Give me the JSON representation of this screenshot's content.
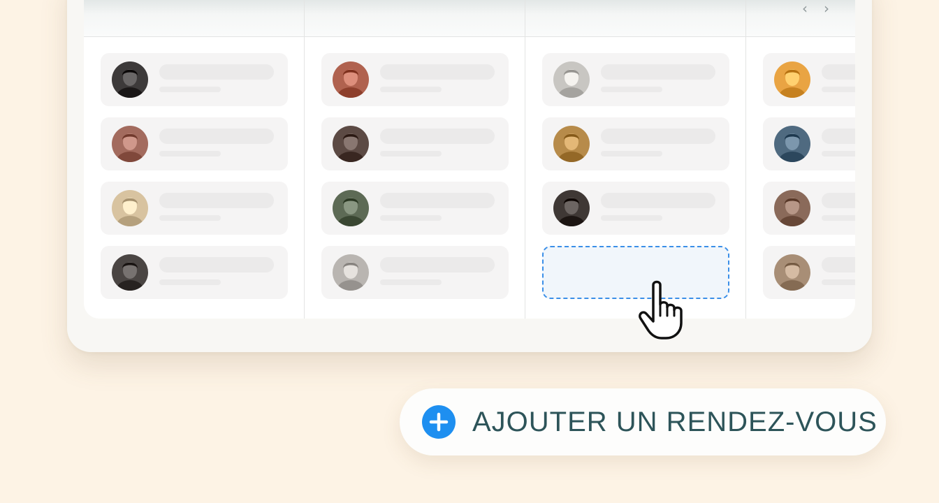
{
  "calendar": {
    "nav": {
      "prev_icon": "chevron-left-icon",
      "next_icon": "chevron-right-icon"
    },
    "columns": [
      {
        "avatars": [
          "#3d3a3a",
          "#a36b5e",
          "#d8c3a0",
          "#4a4543"
        ]
      },
      {
        "avatars": [
          "#b0624f",
          "#5c4a44",
          "#5d6a55",
          "#b9b5b1"
        ]
      },
      {
        "avatars": [
          "#c8c6c2",
          "#b78b4a",
          "#3f3835"
        ]
      },
      {
        "avatars": [
          "#e9a443",
          "#4f6a80",
          "#8a6a5a",
          "#a88e76"
        ]
      }
    ],
    "drop_slot": {
      "icon": "hand-pointer-icon"
    }
  },
  "add_button": {
    "icon": "plus-icon",
    "label": "AJOUTER UN RENDEZ-VOUS",
    "accent": "#1e8ff0",
    "text_color": "#2d5459"
  }
}
